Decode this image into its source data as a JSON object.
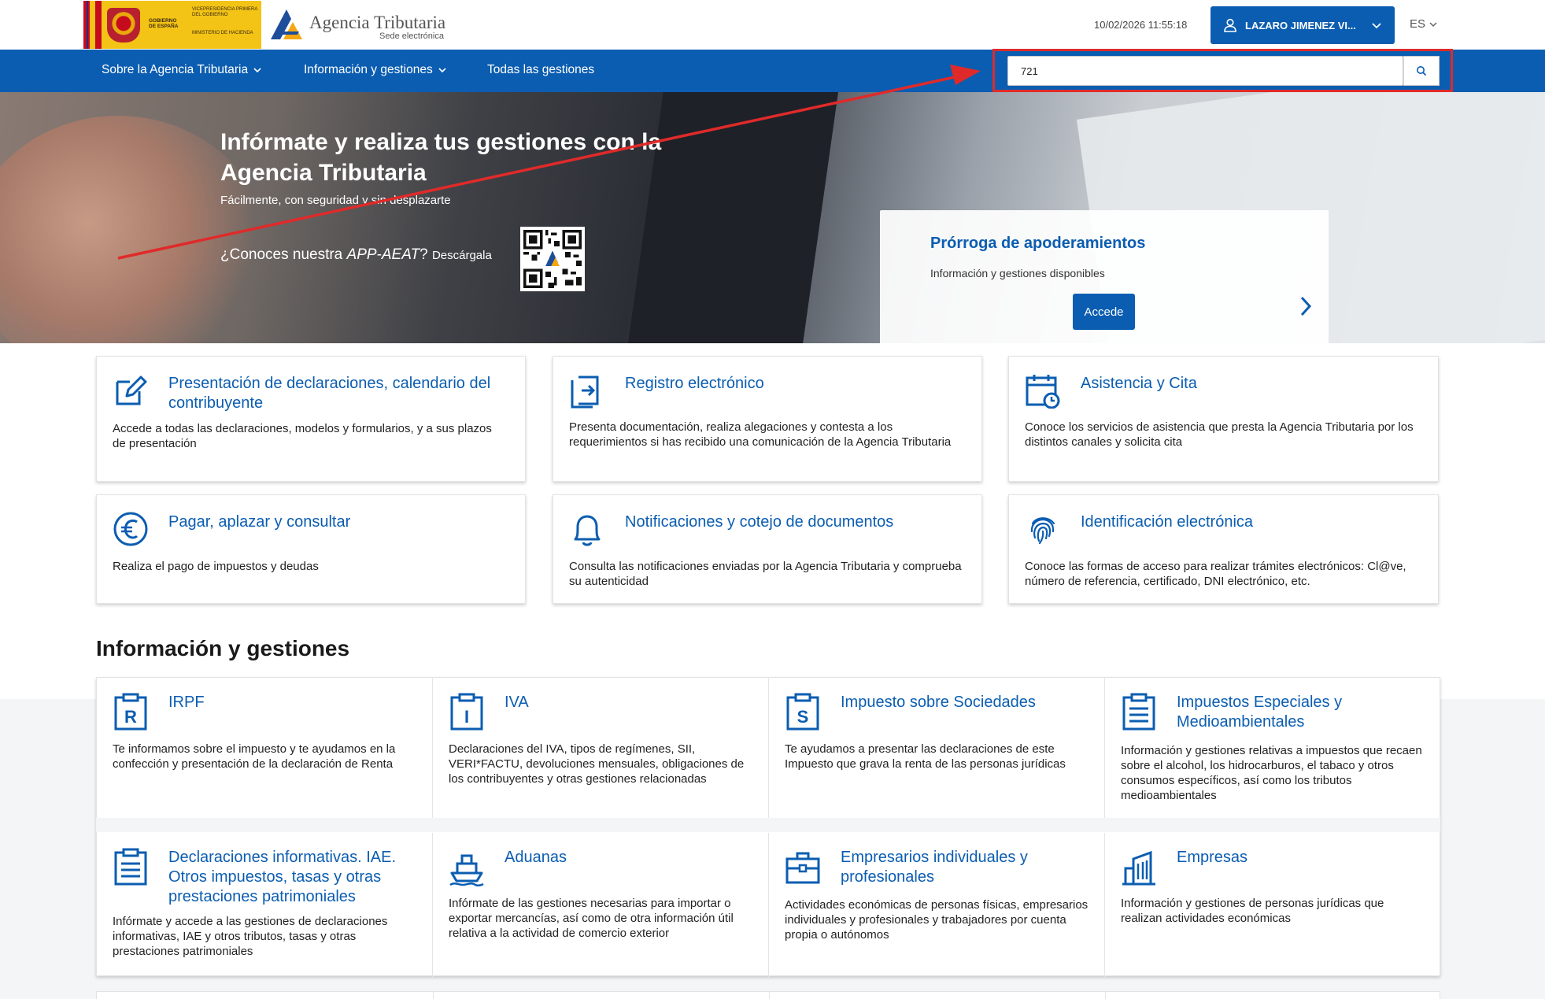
{
  "header": {
    "gov_line1": "GOBIERNO DE ESPAÑA",
    "gov_line2": "VICEPRESIDENCIA PRIMERA DEL GOBIERNO",
    "gov_line3": "MINISTERIO DE HACIENDA",
    "agency_title": "Agencia Tributaria",
    "agency_subtitle": "Sede electrónica",
    "datetime": "10/02/2026 11:55:18",
    "user_name": "LAZARO JIMENEZ VI...",
    "language": "ES"
  },
  "nav": {
    "items": [
      {
        "label": "Sobre la Agencia Tributaria",
        "has_dropdown": true
      },
      {
        "label": "Información y gestiones",
        "has_dropdown": true
      },
      {
        "label": "Todas las gestiones",
        "has_dropdown": false
      }
    ],
    "search_value": "721",
    "search_icon": "search-icon"
  },
  "hero": {
    "title": "Infórmate y realiza tus gestiones con la Agencia Tributaria",
    "subtitle": "Fácilmente, con seguridad y sin desplazarte",
    "app_prefix": "¿Conoces nuestra ",
    "app_name": "APP-AEAT",
    "app_q": "? ",
    "app_download": "Descárgala"
  },
  "promo": {
    "title": "Prórroga de apoderamientos",
    "subtitle": "Información y gestiones disponibles",
    "button": "Accede",
    "slides": 6,
    "active_slide": 1
  },
  "services": [
    {
      "icon": "edit-icon",
      "title": "Presentación de declaraciones, calendario del contribuyente",
      "desc": "Accede a todas las declaraciones, modelos y formularios, y a sus plazos de presentación"
    },
    {
      "icon": "register-icon",
      "title": "Registro electrónico",
      "desc": "Presenta documentación, realiza alegaciones y contesta a los requerimientos si has recibido una comunicación de la Agencia Tributaria"
    },
    {
      "icon": "calendar-clock-icon",
      "title": "Asistencia y Cita",
      "desc": "Conoce los servicios de asistencia que presta la Agencia Tributaria por los distintos canales y solicita cita"
    },
    {
      "icon": "euro-icon",
      "title": "Pagar, aplazar y consultar",
      "desc": "Realiza el pago de impuestos y deudas"
    },
    {
      "icon": "bell-icon",
      "title": "Notificaciones y cotejo de documentos",
      "desc": "Consulta las notificaciones enviadas por la Agencia Tributaria y comprueba su autenticidad"
    },
    {
      "icon": "fingerprint-icon",
      "title": "Identificación electrónica",
      "desc": "Conoce las formas de acceso para realizar trámites electrónicos: Cl@ve, número de referencia, certificado, DNI electrónico, etc."
    }
  ],
  "info_section": {
    "title": "Información y gestiones",
    "tiles": [
      {
        "icon": "irpf-icon",
        "title": "IRPF",
        "desc": "Te informamos sobre el impuesto y te ayudamos en la confección y presentación de la declaración de Renta"
      },
      {
        "icon": "iva-icon",
        "title": "IVA",
        "desc": "Declaraciones del IVA, tipos de regímenes, SII, VERI*FACTU, devoluciones mensuales, obligaciones de los contribuyentes y otras gestiones relacionadas"
      },
      {
        "icon": "sociedades-icon",
        "title": "Impuesto sobre Sociedades",
        "desc": "Te ayudamos a presentar las declaraciones de este Impuesto que grava la renta de las personas jurídicas"
      },
      {
        "icon": "clipboard-icon",
        "title": "Impuestos Especiales y Medioambientales",
        "desc": "Información y gestiones relativas a impuestos que recaen sobre el alcohol, los hidrocarburos, el tabaco y otros consumos específicos, así como los tributos medioambientales"
      },
      {
        "icon": "clipboard-list-icon",
        "title": "Declaraciones informativas. IAE. Otros impuestos, tasas y otras prestaciones patrimoniales",
        "desc": "Infórmate y accede a las gestiones de declaraciones informativas, IAE y otros tributos, tasas y otras prestaciones patrimoniales"
      },
      {
        "icon": "ship-icon",
        "title": "Aduanas",
        "desc": "Infórmate de las gestiones necesarias para importar o exportar mercancías, así como de otra información útil relativa a la actividad de comercio exterior"
      },
      {
        "icon": "briefcase-icon",
        "title": "Empresarios individuales y profesionales",
        "desc": "Actividades económicas de personas físicas, empresarios individuales y profesionales y trabajadores por cuenta propia o autónomos"
      },
      {
        "icon": "building-icon",
        "title": "Empresas",
        "desc": "Información y gestiones de personas jurídicas que realizan actividades económicas"
      }
    ]
  },
  "colors": {
    "primary": "#0b5db1",
    "annotation": "#e02a2a",
    "gov_yellow": "#f3c316"
  }
}
